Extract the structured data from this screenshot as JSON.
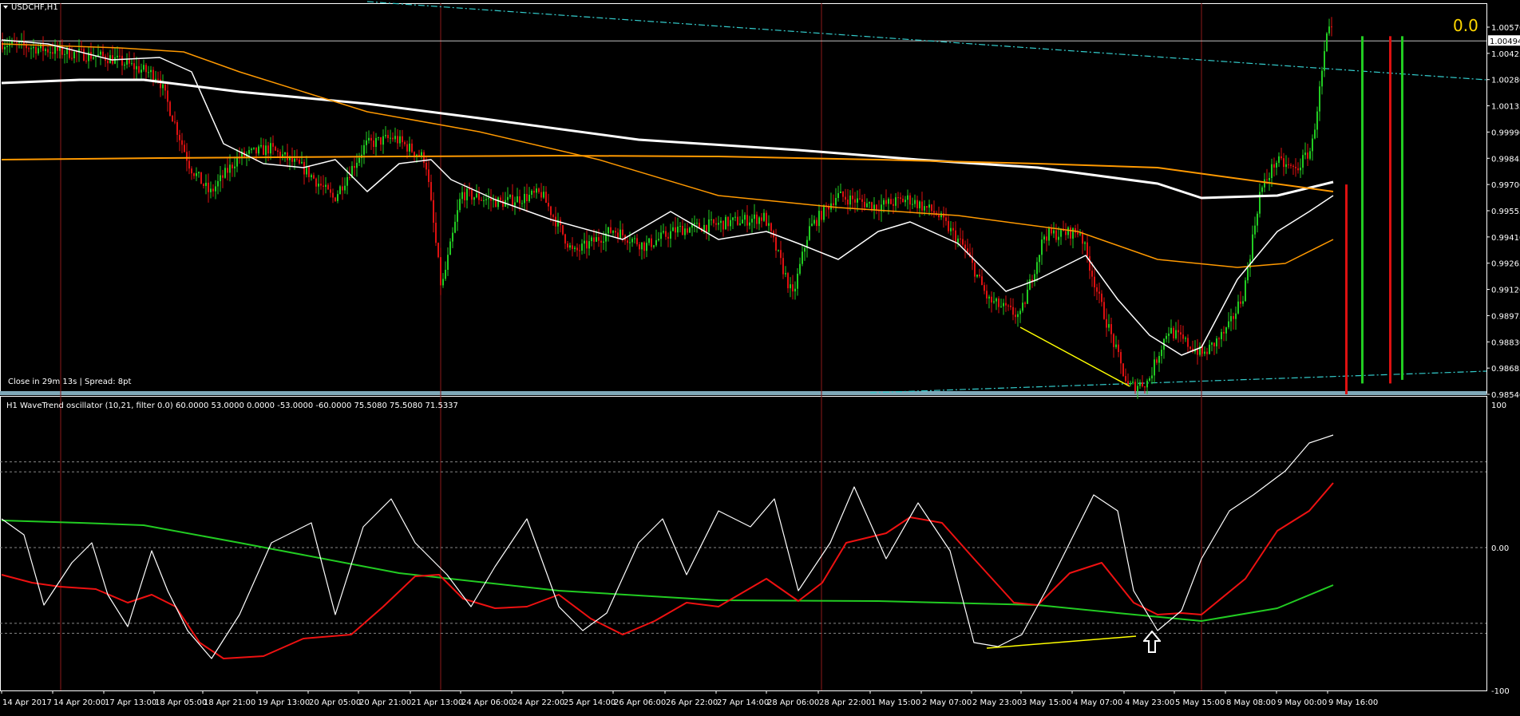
{
  "window": {
    "title": "USDCHF,H1",
    "close_info": "Close in 29m 13s | Spread: 8pt",
    "corner_value": "0.0"
  },
  "price_axis": {
    "current_price": "1.00494",
    "labels": [
      "1.00570",
      "1.00425",
      "1.00280",
      "1.00135",
      "0.99990",
      "0.99845",
      "0.99700",
      "0.99555",
      "0.99410",
      "0.99265",
      "0.99120",
      "0.98975",
      "0.98830",
      "0.98685",
      "0.98540"
    ]
  },
  "oscillator": {
    "title": "H1 WaveTrend oscillator (10,21, filter 0.0) 60.0000 53.0000 0.0000 -53.0000 -60.0000 75.5080 75.5080 71.5337",
    "axis_labels": [
      "100",
      "0.00",
      "-100"
    ],
    "levels": [
      60,
      53,
      0,
      -53,
      -60
    ]
  },
  "time_axis": {
    "labels": [
      "14 Apr 2017",
      "14 Apr 20:00",
      "17 Apr 13:00",
      "18 Apr 05:00",
      "18 Apr 21:00",
      "19 Apr 13:00",
      "20 Apr 05:00",
      "20 Apr 21:00",
      "21 Apr 13:00",
      "24 Apr 06:00",
      "24 Apr 22:00",
      "25 Apr 14:00",
      "26 Apr 06:00",
      "26 Apr 22:00",
      "27 Apr 14:00",
      "28 Apr 06:00",
      "28 Apr 22:00",
      "1 May 15:00",
      "2 May 07:00",
      "2 May 23:00",
      "3 May 15:00",
      "4 May 07:00",
      "4 May 23:00",
      "5 May 15:00",
      "8 May 08:00",
      "9 May 00:00",
      "9 May 16:00"
    ]
  },
  "colors": {
    "background": "#000000",
    "bull": "#22cc22",
    "bear": "#dd1111",
    "ma_white": "#ffffff",
    "ma_orange": "#ff9900",
    "trendline": "#33cccc",
    "divergence": "#ffff00",
    "wt1": "#ffffff",
    "wt2": "#ee1111",
    "ma_green": "#22cc22",
    "separator": "#7fa8b8",
    "vline": "#8b1a1a",
    "axis_text": "#ffffff"
  }
}
